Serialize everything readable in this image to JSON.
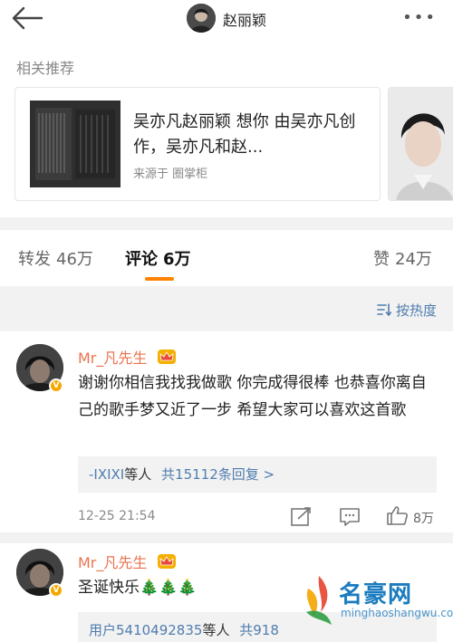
{
  "header": {
    "title": "赵丽颖",
    "more": "•••"
  },
  "related": {
    "label": "相关推荐",
    "card": {
      "title": "吴亦凡赵丽颖 想你 由吴亦凡创作，吴亦凡和赵...",
      "source": "来源于 圈掌柜"
    }
  },
  "tabs": [
    {
      "label": "转发",
      "count": "46万"
    },
    {
      "label": "评论",
      "count": "6万"
    },
    {
      "label": "赞",
      "count": "24万"
    }
  ],
  "sort": {
    "label": "按热度"
  },
  "comments": [
    {
      "author": "Mr_凡先生",
      "text": "谢谢你相信我找我做歌 你完成得很棒 也恭喜你离自己的歌手梦又近了一步 希望大家可以喜欢这首歌",
      "reply_user": "-IXIXI",
      "reply_suffix": "等人",
      "reply_count": "共15112条回复 >",
      "time": "12-25 21:54",
      "likes": "8万"
    },
    {
      "author": "Mr_凡先生",
      "text": "圣诞快乐🎄🎄🎄",
      "reply_user": "用户5410492835",
      "reply_suffix": "等人",
      "reply_count": "共918"
    }
  ],
  "watermark": {
    "title": "名豪网",
    "url": "minghaoshangwu.com"
  },
  "colors": {
    "accent": "#ff8200",
    "name": "#eb7350",
    "link": "#507daf",
    "divider": "#f2f2f2"
  }
}
